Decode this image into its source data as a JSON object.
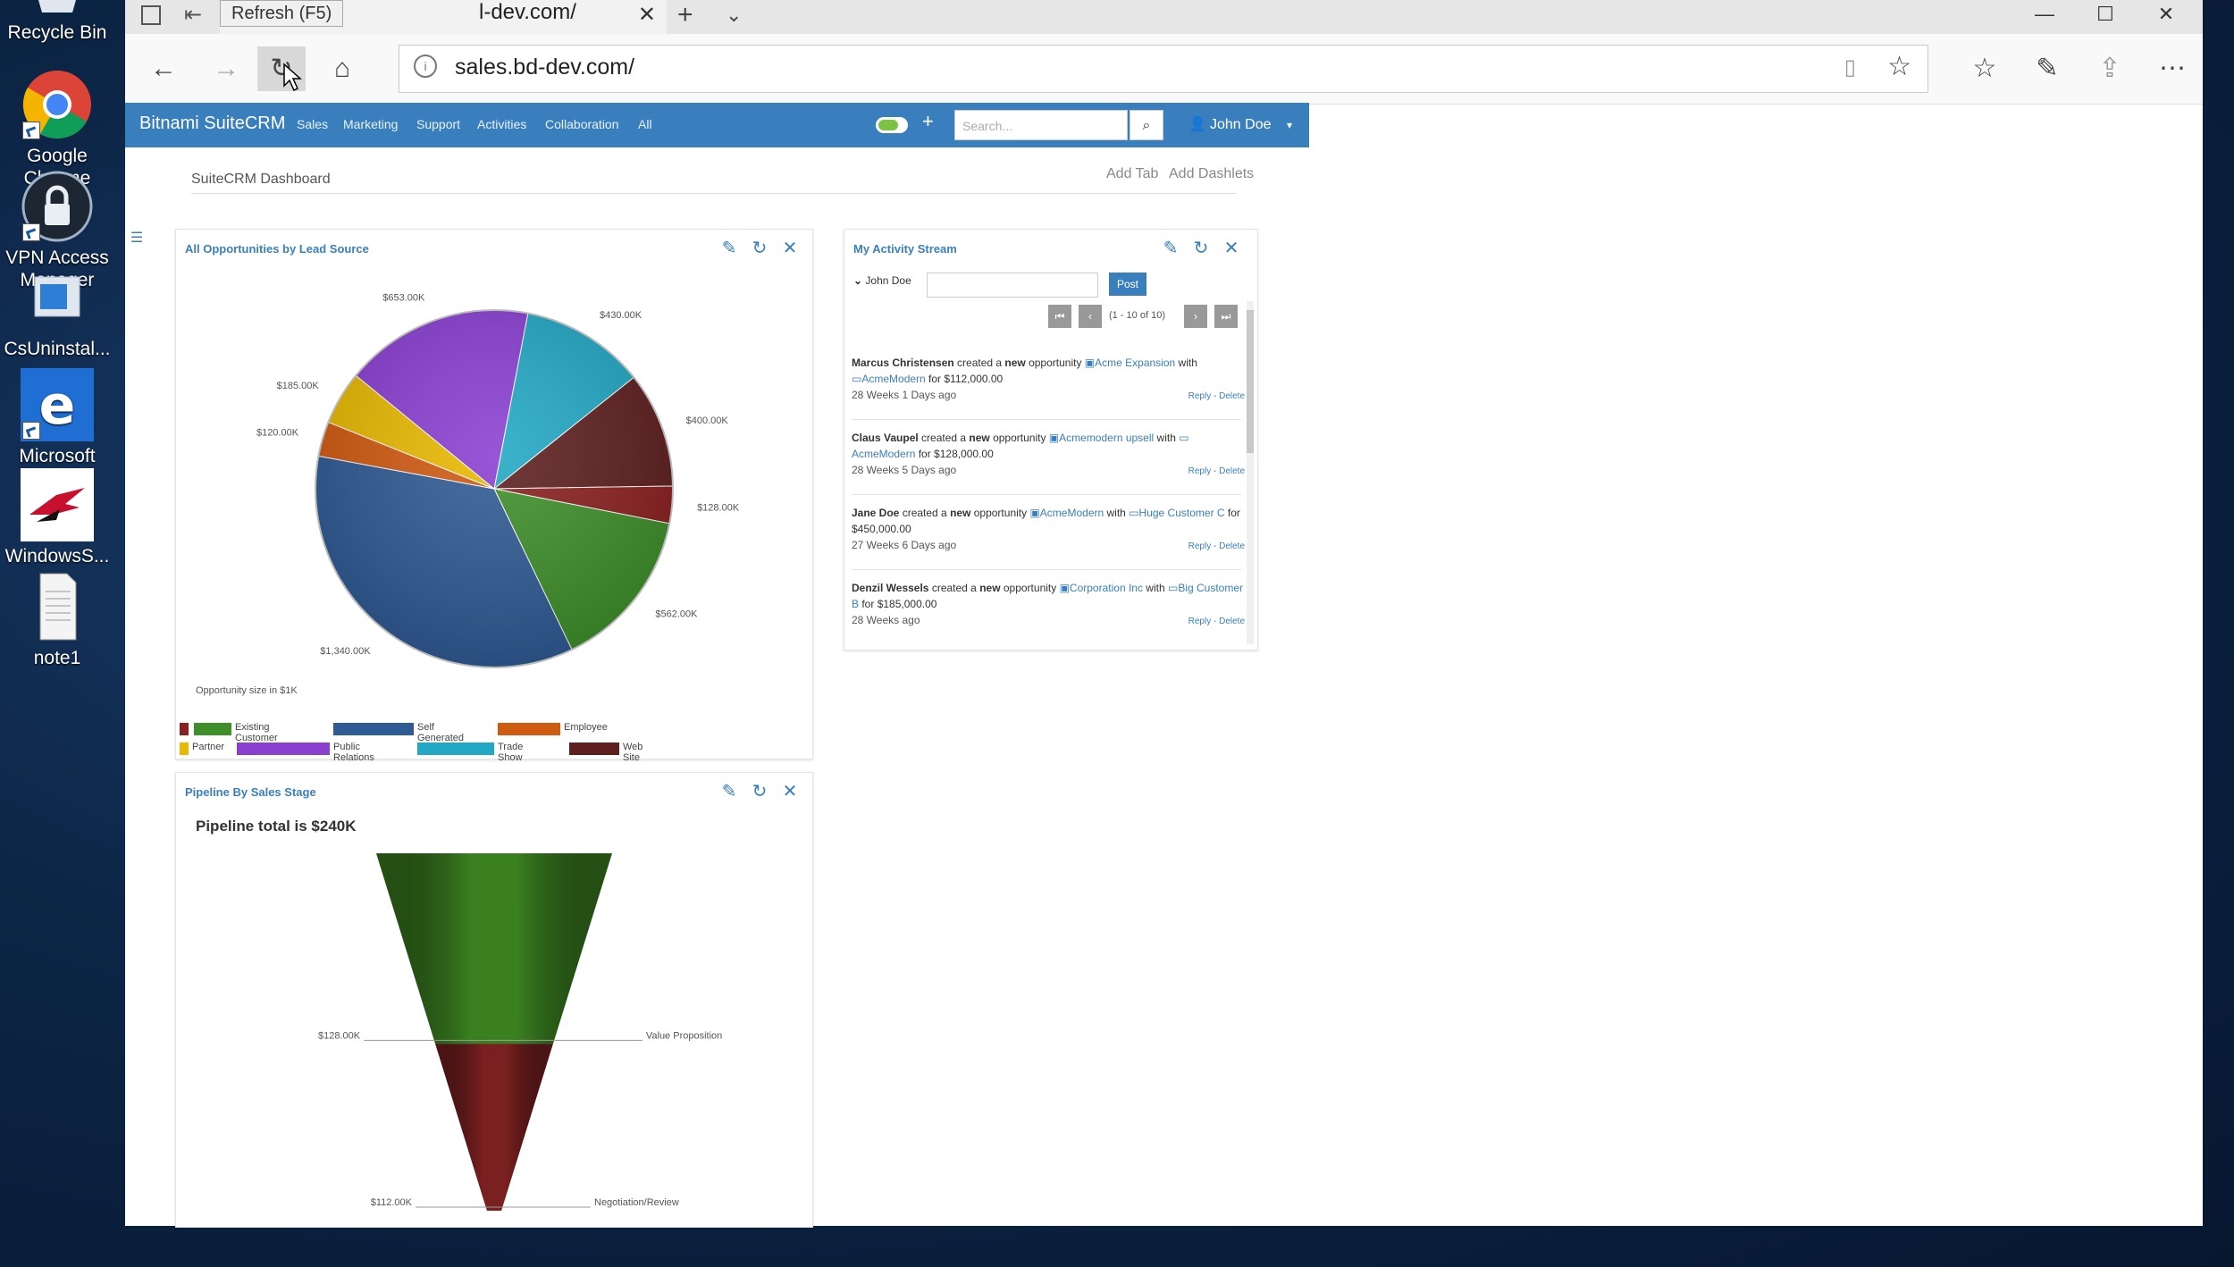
{
  "desktop": {
    "icons": [
      {
        "label": "Recycle Bin",
        "icon": "recycle-bin-icon"
      },
      {
        "label": "Google Chrome",
        "icon": "chrome-icon"
      },
      {
        "label": "VPN Access Manager",
        "icon": "vpn-lock-icon"
      },
      {
        "label": "CsUninstal...",
        "icon": "uninstaller-icon"
      },
      {
        "label": "Microsoft Edge",
        "icon": "edge-icon"
      },
      {
        "label": "WindowsS...",
        "icon": "bird-logo-icon"
      },
      {
        "label": "note1",
        "icon": "text-document-icon"
      }
    ]
  },
  "browser": {
    "tab_title": "l-dev.com/",
    "tooltip": "Refresh (F5)",
    "url": "sales.bd-dev.com/"
  },
  "crm": {
    "brand": "Bitnami SuiteCRM",
    "menu": [
      "Sales",
      "Marketing",
      "Support",
      "Activities",
      "Collaboration",
      "All"
    ],
    "search_placeholder": "Search...",
    "user": "John Doe",
    "dashboard_title": "SuiteCRM Dashboard",
    "add_tab": "Add Tab",
    "add_dashlets": "Add Dashlets"
  },
  "dashlets": {
    "opportunities": {
      "title": "All Opportunities by Lead Source",
      "caption": "Opportunity size in $1K"
    },
    "activity": {
      "title": "My Activity Stream",
      "user": "John Doe",
      "post_label": "Post",
      "pager": "(1 - 10 of 10)",
      "entries": [
        {
          "actor": "Marcus Christensen",
          "verb": " created a ",
          "adj": "new",
          "obj": " opportunity ",
          "link1": "Acme Expansion",
          "with": " with ",
          "link2": "AcmeModern",
          "amount": " for $112,000.00",
          "time": "28 Weeks 1 Days ago",
          "actions": "Reply - Delete"
        },
        {
          "actor": "Claus Vaupel",
          "verb": " created a ",
          "adj": "new",
          "obj": " opportunity ",
          "link1": "Acmemodern upsell",
          "with": " with ",
          "link2": "AcmeModern",
          "amount": " for $128,000.00",
          "time": "28 Weeks 5 Days ago",
          "actions": "Reply - Delete"
        },
        {
          "actor": "Jane Doe",
          "verb": " created a ",
          "adj": "new",
          "obj": " opportunity ",
          "link1": "AcmeModern",
          "with": " with ",
          "link2": "Huge Customer C",
          "amount": " for $450,000.00",
          "time": "27 Weeks 6 Days ago",
          "actions": "Reply - Delete"
        },
        {
          "actor": "Denzil Wessels",
          "verb": " created a ",
          "adj": "new",
          "obj": " opportunity ",
          "link1": "Corporation Inc",
          "with": " with ",
          "link2": "Big Customer B",
          "amount": " for $185,000.00",
          "time": "28 Weeks ago",
          "actions": "Reply - Delete"
        }
      ]
    },
    "pipeline": {
      "title": "Pipeline By Sales Stage",
      "total": "Pipeline total is $240K"
    }
  },
  "chart_data": [
    {
      "type": "pie",
      "title": "All Opportunities by Lead Source",
      "caption": "Opportunity size in $1K",
      "slices": [
        {
          "label": "$430.00K",
          "value": 430,
          "color": "#22a8c4"
        },
        {
          "label": "$400.00K",
          "value": 400,
          "color": "#5e1f1f"
        },
        {
          "label": "$128.00K",
          "value": 128,
          "color": "#8b2020"
        },
        {
          "label": "$562.00K",
          "value": 562,
          "color": "#3e8f2a"
        },
        {
          "label": "$1,340.00K",
          "value": 1340,
          "color": "#2f5b94"
        },
        {
          "label": "$120.00K",
          "value": 120,
          "color": "#d05a10"
        },
        {
          "label": "$185.00K",
          "value": 185,
          "color": "#e8b900"
        },
        {
          "label": "$653.00K",
          "value": 653,
          "color": "#8a3fd1"
        }
      ],
      "legend": [
        {
          "name": "",
          "color": "#8b2020"
        },
        {
          "name": "Existing Customer",
          "color": "#3e8f2a"
        },
        {
          "name": "Self Generated",
          "color": "#2f5b94"
        },
        {
          "name": "Employee",
          "color": "#d05a10"
        },
        {
          "name": "Partner",
          "color": "#e8b900"
        },
        {
          "name": "Public Relations",
          "color": "#8a3fd1"
        },
        {
          "name": "Trade Show",
          "color": "#22a8c4"
        },
        {
          "name": "Web Site",
          "color": "#5e1f1f"
        }
      ]
    },
    {
      "type": "funnel",
      "title": "Pipeline total is $240K",
      "stages": [
        {
          "name": "Value Proposition",
          "value": 128,
          "label": "$128.00K",
          "color": "#3a7f20"
        },
        {
          "name": "Negotiation/Review",
          "value": 112,
          "label": "$112.00K",
          "color": "#7a2020"
        }
      ]
    }
  ]
}
